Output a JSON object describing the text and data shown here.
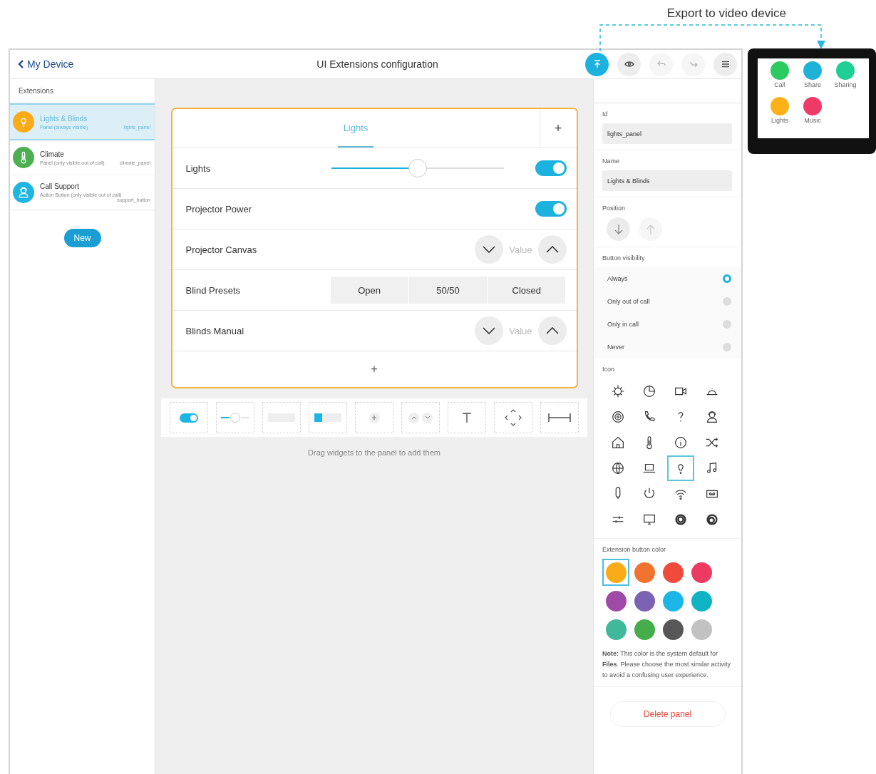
{
  "annotation": {
    "label": "Export to video device"
  },
  "header": {
    "back": "My Device",
    "title": "UI Extensions configuration",
    "buttons": [
      {
        "kind": "export",
        "disabled": false
      },
      {
        "kind": "preview",
        "disabled": false
      },
      {
        "kind": "undo",
        "disabled": true
      },
      {
        "kind": "redo",
        "disabled": true
      },
      {
        "kind": "menu",
        "disabled": false
      }
    ]
  },
  "sidebar": {
    "heading": "Extensions",
    "new_button": "New",
    "items": [
      {
        "name": "Lights & Blinds",
        "description": "Panel (always visible)",
        "id": "lights_panel",
        "color": "#fbab18",
        "selected": true
      },
      {
        "name": "Climate",
        "description": "Panel (only visible out of call)",
        "id": "climate_panel",
        "color": "#4caf50",
        "selected": false
      },
      {
        "name": "Call Support",
        "description": "Action Button (only visible out of call)",
        "id": "support_button",
        "color": "#1eb6e0",
        "selected": false
      }
    ]
  },
  "panel": {
    "tabs": [
      {
        "label": "Lights",
        "selected": true
      }
    ],
    "add_tab": "+",
    "add_row": "+",
    "rows": [
      {
        "kind": "slider",
        "label": "Lights",
        "level": 0.5,
        "on": true
      },
      {
        "kind": "toggle",
        "label": "Projector Power",
        "on": true
      },
      {
        "kind": "spinner",
        "label": "Projector Canvas",
        "value": "Value"
      },
      {
        "kind": "buttons",
        "label": "Blind Presets",
        "buttons": [
          "Open",
          "50/50",
          "Closed"
        ]
      },
      {
        "kind": "spinner",
        "label": "Blinds Manual",
        "value": "Value"
      }
    ]
  },
  "palette": {
    "hint": "Drag widgets to the panel to add them"
  },
  "properties": {
    "id_label": "Id",
    "id_value": "lights_panel",
    "name_label": "Name",
    "name_value": "Lights & Blinds",
    "position_label": "Position",
    "position_buttons": [
      {
        "kind": "down",
        "disabled": false
      },
      {
        "kind": "up",
        "disabled": true
      }
    ],
    "visibility_label": "Button visibility",
    "visibility": [
      {
        "label": "Always",
        "selected": true
      },
      {
        "label": "Only out of call",
        "selected": false
      },
      {
        "label": "Only in call",
        "selected": false
      },
      {
        "label": "Never",
        "selected": false
      }
    ],
    "icon_label": "Icon",
    "icons": [
      {
        "selected": false
      },
      {
        "selected": false
      },
      {
        "selected": false
      },
      {
        "selected": false
      },
      {
        "selected": false
      },
      {
        "selected": false
      },
      {
        "selected": false
      },
      {
        "selected": false
      },
      {
        "selected": false
      },
      {
        "selected": false
      },
      {
        "selected": false
      },
      {
        "selected": false
      },
      {
        "selected": false
      },
      {
        "selected": false
      },
      {
        "selected": true
      },
      {
        "selected": false
      },
      {
        "selected": false
      },
      {
        "selected": false
      },
      {
        "selected": false
      },
      {
        "selected": false
      },
      {
        "selected": false
      },
      {
        "selected": false
      },
      {
        "selected": false
      },
      {
        "selected": false
      }
    ],
    "color_label": "Extension button color",
    "colors": [
      {
        "color": "#fbab18",
        "selected": true
      },
      {
        "color": "#f0732f",
        "selected": false
      },
      {
        "color": "#ef4a3c",
        "selected": false
      },
      {
        "color": "#ec3a63",
        "selected": false
      },
      {
        "color": "#a04aa8",
        "selected": false
      },
      {
        "color": "#7c62b2",
        "selected": false
      },
      {
        "color": "#1cb6e6",
        "selected": false
      },
      {
        "color": "#0fb3c4",
        "selected": false
      },
      {
        "color": "#41b899",
        "selected": false
      },
      {
        "color": "#45ad4c",
        "selected": false
      },
      {
        "color": "#575757",
        "selected": false
      },
      {
        "color": "#c2c2c2",
        "selected": false
      }
    ],
    "note": "**Note:** This color is the system default for **Files**. Please choose the most similar activity to avoid a confusing user experience.",
    "delete_button": "Delete panel"
  },
  "device": {
    "apps": [
      {
        "label": "Call",
        "color": "#2dca62"
      },
      {
        "label": "Share",
        "color": "#1eb3d6"
      },
      {
        "label": "Sharing",
        "color": "#1fcf96"
      },
      {
        "label": "Lights",
        "color": "#fbb117"
      },
      {
        "label": "Music",
        "color": "#ef3a67"
      }
    ]
  }
}
